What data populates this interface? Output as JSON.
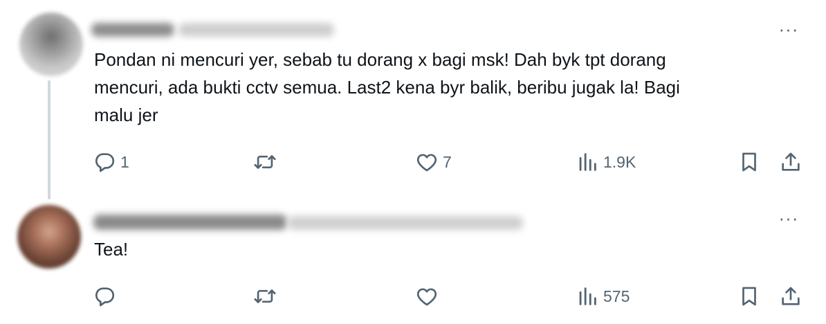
{
  "replies": [
    {
      "text": "Pondan ni mencuri yer, sebab tu dorang x bagi msk! Dah byk tpt dorang\nmencuri, ada bukti cctv semua. Last2 kena byr balik, beribu jugak la! Bagi\nmalu jer",
      "more_label": "···",
      "stats": {
        "replies": "1",
        "retweets": "",
        "likes": "7",
        "views": "1.9K"
      },
      "icons": [
        "reply-icon",
        "retweet-icon",
        "like-icon",
        "views-icon",
        "bookmark-icon",
        "share-icon"
      ]
    },
    {
      "text": "Tea!",
      "more_label": "···",
      "stats": {
        "replies": "",
        "retweets": "",
        "likes": "",
        "views": "575"
      },
      "icons": [
        "reply-icon",
        "retweet-icon",
        "like-icon",
        "views-icon",
        "bookmark-icon",
        "share-icon"
      ]
    }
  ],
  "colors": {
    "text": "#0f1419",
    "secondary": "#536471",
    "thread_line": "#cfd9de"
  }
}
